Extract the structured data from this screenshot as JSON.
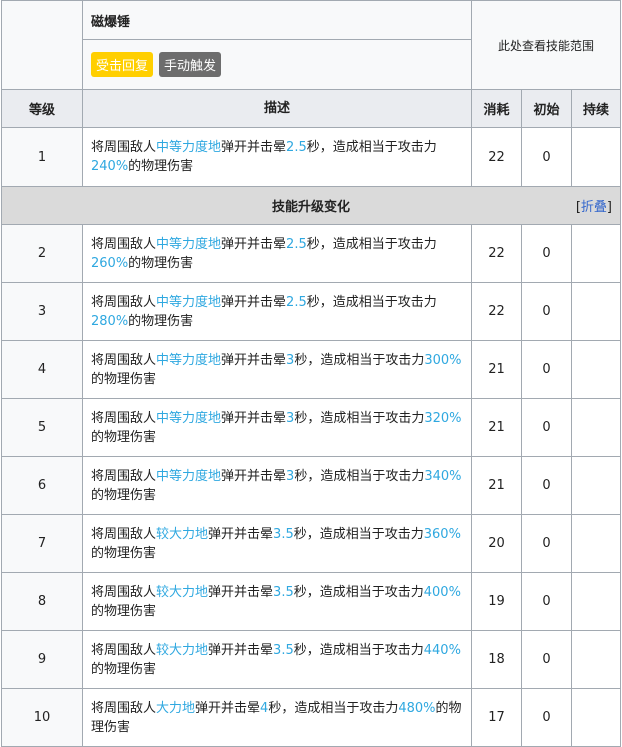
{
  "skill": {
    "name": "磁爆锤",
    "tags": [
      "受击回复",
      "手动触发"
    ],
    "range_text": "此处查看技能范围"
  },
  "headers": {
    "level": "等级",
    "desc": "描述",
    "cost": "消耗",
    "init": "初始",
    "duration": "持续"
  },
  "upgrade": {
    "title": "技能升级变化",
    "collapse_prefix": "[",
    "collapse_link": "折叠",
    "collapse_suffix": "]"
  },
  "colors": {
    "highlight": "#2fa8e0",
    "tag_yellow": "#ffcf00",
    "tag_gray": "#6d6d6d",
    "link": "#3366cc"
  },
  "levels": [
    {
      "level": "1",
      "p1": "将周围敌人",
      "h1": "中等力度地",
      "p2": "弹开并击晕",
      "h2": "2.5",
      "p3": "秒，造成相当于攻击力",
      "h3": "240%",
      "p4": "的物理伤害",
      "cost": "22",
      "init": "0",
      "duration": ""
    },
    {
      "level": "2",
      "p1": "将周围敌人",
      "h1": "中等力度地",
      "p2": "弹开并击晕",
      "h2": "2.5",
      "p3": "秒，造成相当于攻击力",
      "h3": "260%",
      "p4": "的物理伤害",
      "cost": "22",
      "init": "0",
      "duration": ""
    },
    {
      "level": "3",
      "p1": "将周围敌人",
      "h1": "中等力度地",
      "p2": "弹开并击晕",
      "h2": "2.5",
      "p3": "秒，造成相当于攻击力",
      "h3": "280%",
      "p4": "的物理伤害",
      "cost": "22",
      "init": "0",
      "duration": ""
    },
    {
      "level": "4",
      "p1": "将周围敌人",
      "h1": "中等力度地",
      "p2": "弹开并击晕",
      "h2": "3",
      "p3": "秒，造成相当于攻击力",
      "h3": "300%",
      "p4": "的物理伤害",
      "cost": "21",
      "init": "0",
      "duration": ""
    },
    {
      "level": "5",
      "p1": "将周围敌人",
      "h1": "中等力度地",
      "p2": "弹开并击晕",
      "h2": "3",
      "p3": "秒，造成相当于攻击力",
      "h3": "320%",
      "p4": "的物理伤害",
      "cost": "21",
      "init": "0",
      "duration": ""
    },
    {
      "level": "6",
      "p1": "将周围敌人",
      "h1": "中等力度地",
      "p2": "弹开并击晕",
      "h2": "3",
      "p3": "秒，造成相当于攻击力",
      "h3": "340%",
      "p4": "的物理伤害",
      "cost": "21",
      "init": "0",
      "duration": ""
    },
    {
      "level": "7",
      "p1": "将周围敌人",
      "h1": "较大力地",
      "p2": "弹开并击晕",
      "h2": "3.5",
      "p3": "秒，造成相当于攻击力",
      "h3": "360%",
      "p4": "的物理伤害",
      "cost": "20",
      "init": "0",
      "duration": ""
    },
    {
      "level": "8",
      "p1": "将周围敌人",
      "h1": "较大力地",
      "p2": "弹开并击晕",
      "h2": "3.5",
      "p3": "秒，造成相当于攻击力",
      "h3": "400%",
      "p4": "的物理伤害",
      "cost": "19",
      "init": "0",
      "duration": ""
    },
    {
      "level": "9",
      "p1": "将周围敌人",
      "h1": "较大力地",
      "p2": "弹开并击晕",
      "h2": "3.5",
      "p3": "秒，造成相当于攻击力",
      "h3": "440%",
      "p4": "的物理伤害",
      "cost": "18",
      "init": "0",
      "duration": ""
    },
    {
      "level": "10",
      "p1": "将周围敌人",
      "h1": "大力地",
      "p2": "弹开并击晕",
      "h2": "4",
      "p3": "秒，造成相当于攻击力",
      "h3": "480%",
      "p4": "的物理伤害",
      "cost": "17",
      "init": "0",
      "duration": ""
    }
  ]
}
